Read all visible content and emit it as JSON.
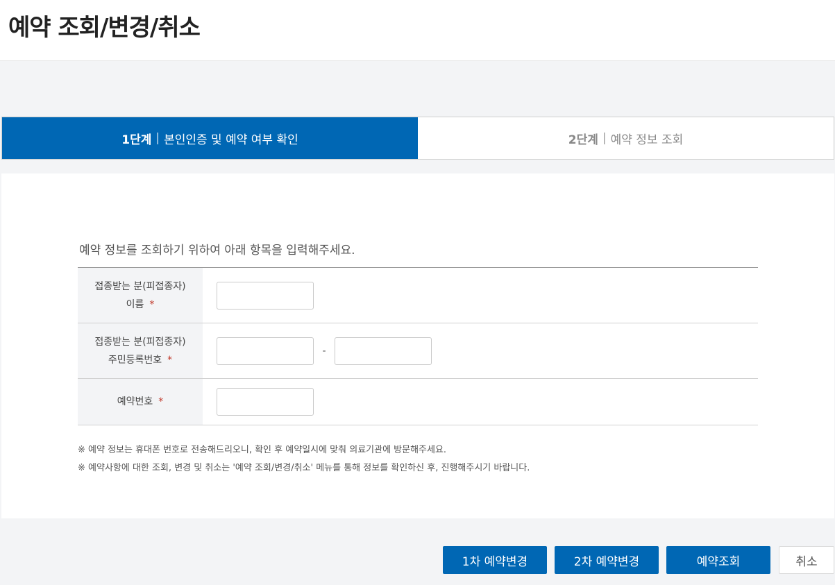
{
  "page": {
    "title": "예약 조회/변경/취소"
  },
  "steps": [
    {
      "num": "1단계",
      "sep": "|",
      "label": "본인인증 및 예약 여부 확인"
    },
    {
      "num": "2단계",
      "sep": "|",
      "label": "예약 정보 조회"
    }
  ],
  "form": {
    "intro": "예약 정보를 조회하기 위하여 아래 항목을 입력해주세요.",
    "required_mark": "*",
    "name_label_line1": "접종받는 분(피접종자)",
    "name_label_line2": "이름",
    "rrn_label_line1": "접종받는 분(피접종자)",
    "rrn_label_line2": "주민등록번호",
    "rrn_dash": "-",
    "reservation_label": "예약번호",
    "name_value": "",
    "rrn_front_value": "",
    "rrn_back_value": "",
    "reservation_value": ""
  },
  "notes": [
    "※ 예약 정보는 휴대폰 번호로 전송해드리오니, 확인 후 예약일시에 맞춰 의료기관에 방문해주세요.",
    "※ 예약사항에 대한 조회, 변경 및 취소는 '예약 조회/변경/취소' 메뉴를 통해 정보를 확인하신 후, 진행해주시기 바랍니다."
  ],
  "buttons": {
    "change1": "1차 예약변경",
    "change2": "2차 예약변경",
    "lookup": "예약조회",
    "cancel": "취소"
  },
  "colors": {
    "primary": "#0067b4",
    "required": "#c0392b"
  }
}
